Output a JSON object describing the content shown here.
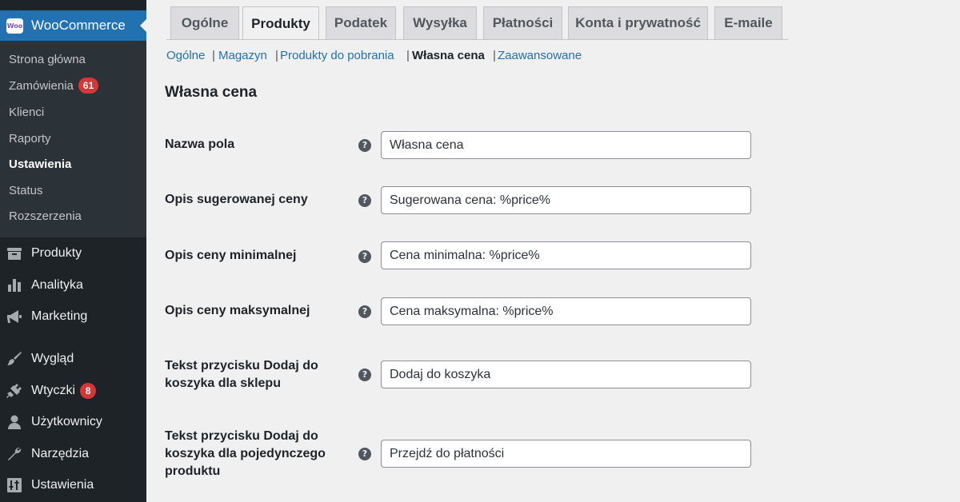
{
  "sidebar": {
    "woocommerce": {
      "title": "WooCommerce",
      "logo_text": "Woo"
    },
    "submenu": [
      {
        "label": "Strona główna"
      },
      {
        "label": "Zamówienia",
        "badge": "61"
      },
      {
        "label": "Klienci"
      },
      {
        "label": "Raporty"
      },
      {
        "label": "Ustawienia",
        "active": true
      },
      {
        "label": "Status"
      },
      {
        "label": "Rozszerzenia"
      }
    ],
    "menu": [
      {
        "label": "Produkty",
        "icon": "archive-icon"
      },
      {
        "label": "Analityka",
        "icon": "bar-chart-icon"
      },
      {
        "label": "Marketing",
        "icon": "megaphone-icon"
      },
      {
        "label": "Wygląd",
        "icon": "paintbrush-icon"
      },
      {
        "label": "Wtyczki",
        "icon": "plug-icon",
        "badge": "8"
      },
      {
        "label": "Użytkownicy",
        "icon": "user-icon"
      },
      {
        "label": "Narzędzia",
        "icon": "wrench-icon"
      },
      {
        "label": "Ustawienia",
        "icon": "settings-sliders-icon"
      }
    ]
  },
  "tabs": [
    {
      "label": "Ogólne"
    },
    {
      "label": "Produkty",
      "active": true
    },
    {
      "label": "Podatek"
    },
    {
      "label": "Wysyłka"
    },
    {
      "label": "Płatności"
    },
    {
      "label": "Konta i prywatność"
    },
    {
      "label": "E-maile"
    }
  ],
  "subnav": [
    {
      "label": "Ogólne"
    },
    {
      "label": "Magazyn"
    },
    {
      "label": "Produkty do pobrania"
    },
    {
      "label": "Własna cena",
      "current": true
    },
    {
      "label": "Zaawansowane"
    }
  ],
  "subnav_separator": "|",
  "section_title": "Własna cena",
  "help_glyph": "?",
  "fields": [
    {
      "label": "Nazwa pola",
      "value": "Własna cena"
    },
    {
      "label": "Opis sugerowanej ceny",
      "value": "Sugerowana cena: %price%"
    },
    {
      "label": "Opis ceny minimalnej",
      "value": "Cena minimalna: %price%"
    },
    {
      "label": "Opis ceny maksymalnej",
      "value": "Cena maksymalna: %price%"
    },
    {
      "label": "Tekst przycisku Dodaj do koszyka dla sklepu",
      "value": "Dodaj do koszyka"
    },
    {
      "label": "Tekst przycisku Dodaj do koszyka dla pojedynczego produktu",
      "value": "Przejdź do płatności"
    }
  ],
  "colors": {
    "sidebar_bg": "#1d2327",
    "submenu_bg": "#2c3338",
    "accent": "#2271b1",
    "badge": "#d63638"
  }
}
